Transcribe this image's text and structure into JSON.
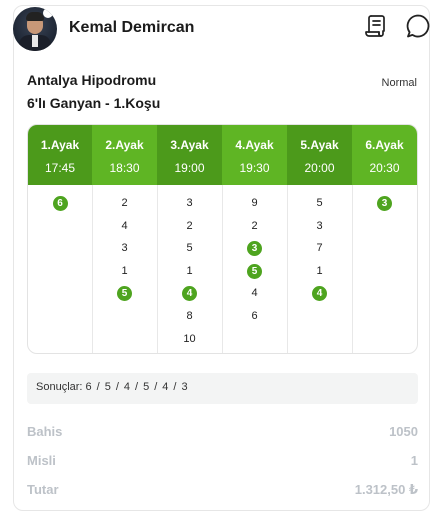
{
  "user": {
    "name": "Kemal Demircan"
  },
  "icons": {
    "receipt": "receipt-icon",
    "chat": "chat-bubble-icon"
  },
  "race": {
    "track": "Antalya Hipodromu",
    "title": "6'lı Ganyan - 1.Koşu",
    "bet_type": "Normal"
  },
  "legs": [
    {
      "name": "1.Ayak",
      "time": "17:45",
      "horses": [
        {
          "n": "6",
          "win": true
        }
      ]
    },
    {
      "name": "2.Ayak",
      "time": "18:30",
      "horses": [
        {
          "n": "2",
          "win": false
        },
        {
          "n": "4",
          "win": false
        },
        {
          "n": "3",
          "win": false
        },
        {
          "n": "1",
          "win": false
        },
        {
          "n": "5",
          "win": true
        }
      ]
    },
    {
      "name": "3.Ayak",
      "time": "19:00",
      "horses": [
        {
          "n": "3",
          "win": false
        },
        {
          "n": "2",
          "win": false
        },
        {
          "n": "5",
          "win": false
        },
        {
          "n": "1",
          "win": false
        },
        {
          "n": "4",
          "win": true
        },
        {
          "n": "8",
          "win": false
        },
        {
          "n": "10",
          "win": false
        }
      ]
    },
    {
      "name": "4.Ayak",
      "time": "19:30",
      "horses": [
        {
          "n": "9",
          "win": false
        },
        {
          "n": "2",
          "win": false
        },
        {
          "n": "3",
          "win": true
        },
        {
          "n": "5",
          "win": true
        },
        {
          "n": "4",
          "win": false
        },
        {
          "n": "6",
          "win": false
        }
      ]
    },
    {
      "name": "5.Ayak",
      "time": "20:00",
      "horses": [
        {
          "n": "5",
          "win": false
        },
        {
          "n": "3",
          "win": false
        },
        {
          "n": "7",
          "win": false
        },
        {
          "n": "1",
          "win": false
        },
        {
          "n": "4",
          "win": true
        }
      ]
    },
    {
      "name": "6.Ayak",
      "time": "20:30",
      "horses": [
        {
          "n": "3",
          "win": true
        }
      ]
    }
  ],
  "results": {
    "label": "Sonuçlar:",
    "values": [
      "6",
      "5",
      "4",
      "5",
      "4",
      "3"
    ],
    "separator": "/"
  },
  "summary": {
    "bahis_label": "Bahis",
    "bahis_value": "1050",
    "misli_label": "Misli",
    "misli_value": "1",
    "tutar_label": "Tutar",
    "tutar_value": "1.312,50 ₺"
  },
  "colors": {
    "header_dark": "#4c9a1b",
    "header_light": "#5fb524",
    "winner": "#4ea41f",
    "muted": "#bdc2c8"
  }
}
